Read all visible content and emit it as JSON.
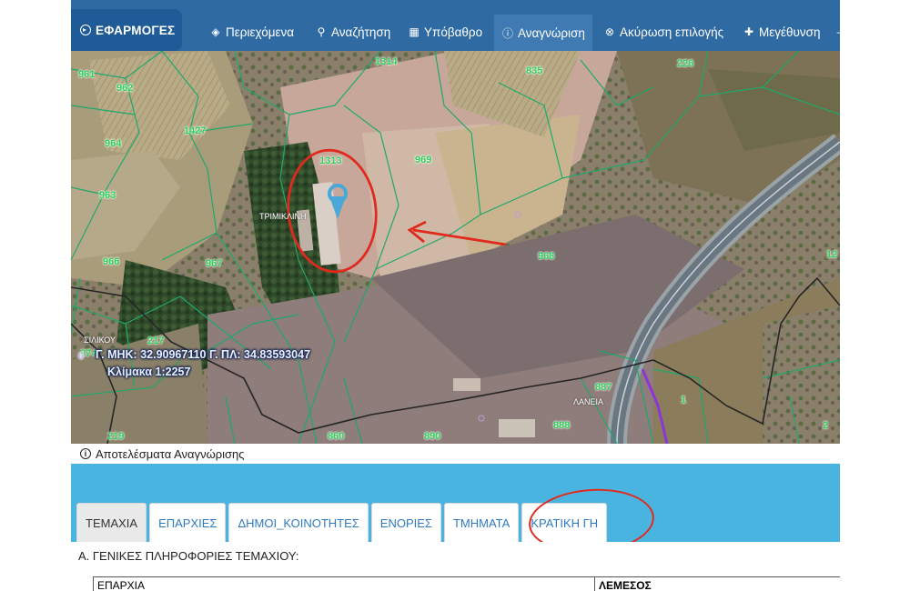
{
  "toolbar": {
    "apps_label": "ΕΦΑΡΜΟΓΕΣ",
    "items": [
      {
        "label": "Περιεχόμενα",
        "icon": "layers-icon"
      },
      {
        "label": "Αναζήτηση",
        "icon": "search-icon"
      },
      {
        "label": "Υπόβαθρο",
        "icon": "grid-icon"
      },
      {
        "label": "Αναγνώριση",
        "icon": "info-icon"
      },
      {
        "label": "Ακύρωση επιλογής",
        "icon": "cancel-icon"
      },
      {
        "label": "Μεγέθυνση",
        "icon": "plus-icon"
      }
    ],
    "active_item": "Αναγνώριση"
  },
  "map": {
    "plot_numbers": [
      "961",
      "962",
      "1314",
      "835",
      "226",
      "964",
      "1427",
      "1313",
      "969",
      "963",
      "966",
      "967",
      "968",
      "12",
      "874",
      "217",
      "887",
      "219",
      "860",
      "890",
      "888",
      "1",
      "2",
      "0",
      "0",
      "0"
    ],
    "place_names": [
      "ΤΡΙΜΙΚΛΙΝΗ",
      "ΣΙΛΙΚΟΥ",
      "ΛΑΝΕΙΑ"
    ],
    "coordinates": "Γ. ΜΗΚ: 32.90967110 Γ. ΠΛ: 34.83593047",
    "scale": "Κλίμακα 1:2257",
    "colors": {
      "parcel_line": "#1fa86b",
      "boundary_line": "#2b2b2b",
      "road_line": "#b0c4d8",
      "annotation_red": "#e02a1e",
      "marker_blue": "#4aa8d8"
    }
  },
  "results": {
    "title": "Αποτελέσματα Αναγνώρισης",
    "tabs": [
      "ΤΕΜΑΧΙΑ",
      "ΕΠΑΡΧΙΕΣ",
      "ΔΗΜΟΙ_ΚΟΙΝΟΤΗΤΕΣ",
      "ΕΝΟΡΙΕΣ",
      "ΤΜΗΜΑΤΑ",
      "ΚΡΑΤΙΚΗ ΓΗ"
    ],
    "active_tab": "ΤΕΜΑΧΙΑ",
    "section_title": "Α. ΓΕΝΙΚΕΣ ΠΛΗΡΟΦΟΡΙΕΣ ΤΕΜΑΧΙΟΥ:",
    "table": [
      {
        "field": "ΕΠΑΡΧΙΑ",
        "value": "ΛΕΜΕΣΟΣ"
      }
    ]
  }
}
